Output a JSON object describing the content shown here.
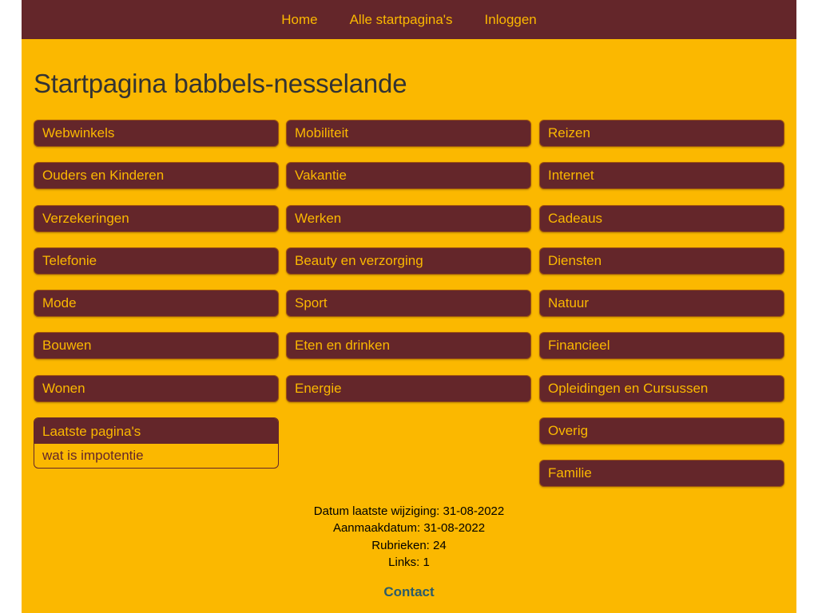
{
  "nav": {
    "items": [
      "Home",
      "Alle startpagina's",
      "Inloggen"
    ]
  },
  "page": {
    "title": "Startpagina babbels-nesselande"
  },
  "columns": {
    "col1": [
      "Webwinkels",
      "Ouders en Kinderen",
      "Verzekeringen",
      "Telefonie",
      "Mode",
      "Bouwen",
      "Wonen"
    ],
    "col2": [
      "Mobiliteit",
      "Vakantie",
      "Werken",
      "Beauty en verzorging",
      "Sport",
      "Eten en drinken",
      "Energie"
    ],
    "col3": [
      "Reizen",
      "Internet",
      "Cadeaus",
      "Diensten",
      "Natuur",
      "Financieel",
      "Opleidingen en Cursussen",
      "Overig",
      "Familie"
    ]
  },
  "latest": {
    "title": "Laatste pagina's",
    "items": [
      "wat is impotentie"
    ]
  },
  "info": {
    "modified": "Datum laatste wijziging: 31-08-2022",
    "created": "Aanmaakdatum: 31-08-2022",
    "rubrieken": "Rubrieken: 24",
    "links": "Links: 1"
  },
  "footer": {
    "contact": "Contact"
  },
  "colors": {
    "background": "#fbb800",
    "brand_dark": "#64262a",
    "link": "#2b5c6b"
  }
}
